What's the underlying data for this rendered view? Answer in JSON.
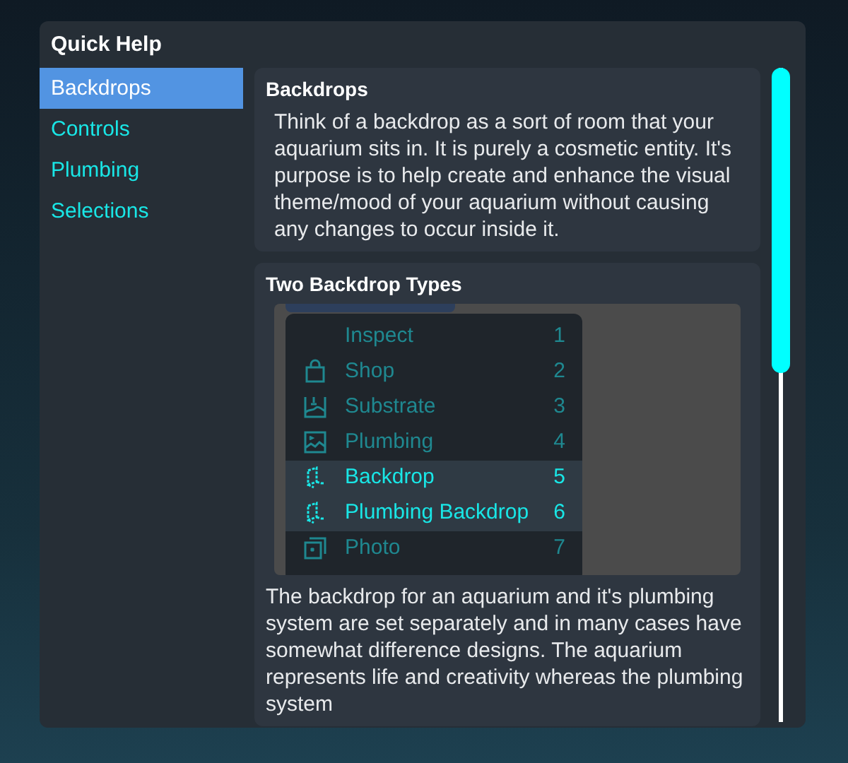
{
  "window": {
    "title": "Quick Help"
  },
  "sidebar": {
    "items": [
      {
        "label": "Backdrops",
        "selected": true
      },
      {
        "label": "Controls",
        "selected": false
      },
      {
        "label": "Plumbing",
        "selected": false
      },
      {
        "label": "Selections",
        "selected": false
      }
    ]
  },
  "sections": [
    {
      "title": "Backdrops",
      "paragraphs": [
        "Think of a backdrop as a sort of room that your aquarium sits in. It is purely a cosmetic entity. It's purpose is to help create and enhance the visual theme/mood of your aquarium without causing any changes to occur inside it."
      ]
    },
    {
      "title": "Two Backdrop Types",
      "screenshot": {
        "menu": [
          {
            "label": "Inspect",
            "key": "1",
            "highlighted": false
          },
          {
            "label": "Shop",
            "key": "2",
            "highlighted": false
          },
          {
            "label": "Substrate",
            "key": "3",
            "highlighted": false
          },
          {
            "label": "Plumbing",
            "key": "4",
            "highlighted": false
          },
          {
            "label": "Backdrop",
            "key": "5",
            "highlighted": true
          },
          {
            "label": "Plumbing Backdrop",
            "key": "6",
            "highlighted": true
          },
          {
            "label": "Photo",
            "key": "7",
            "highlighted": false
          }
        ]
      },
      "paragraphs": [
        "The backdrop for an aquarium and it's plumbing system are set separately and in many cases have somewhat difference designs. The aquarium represents life and creativity whereas the plumbing system"
      ]
    }
  ]
}
